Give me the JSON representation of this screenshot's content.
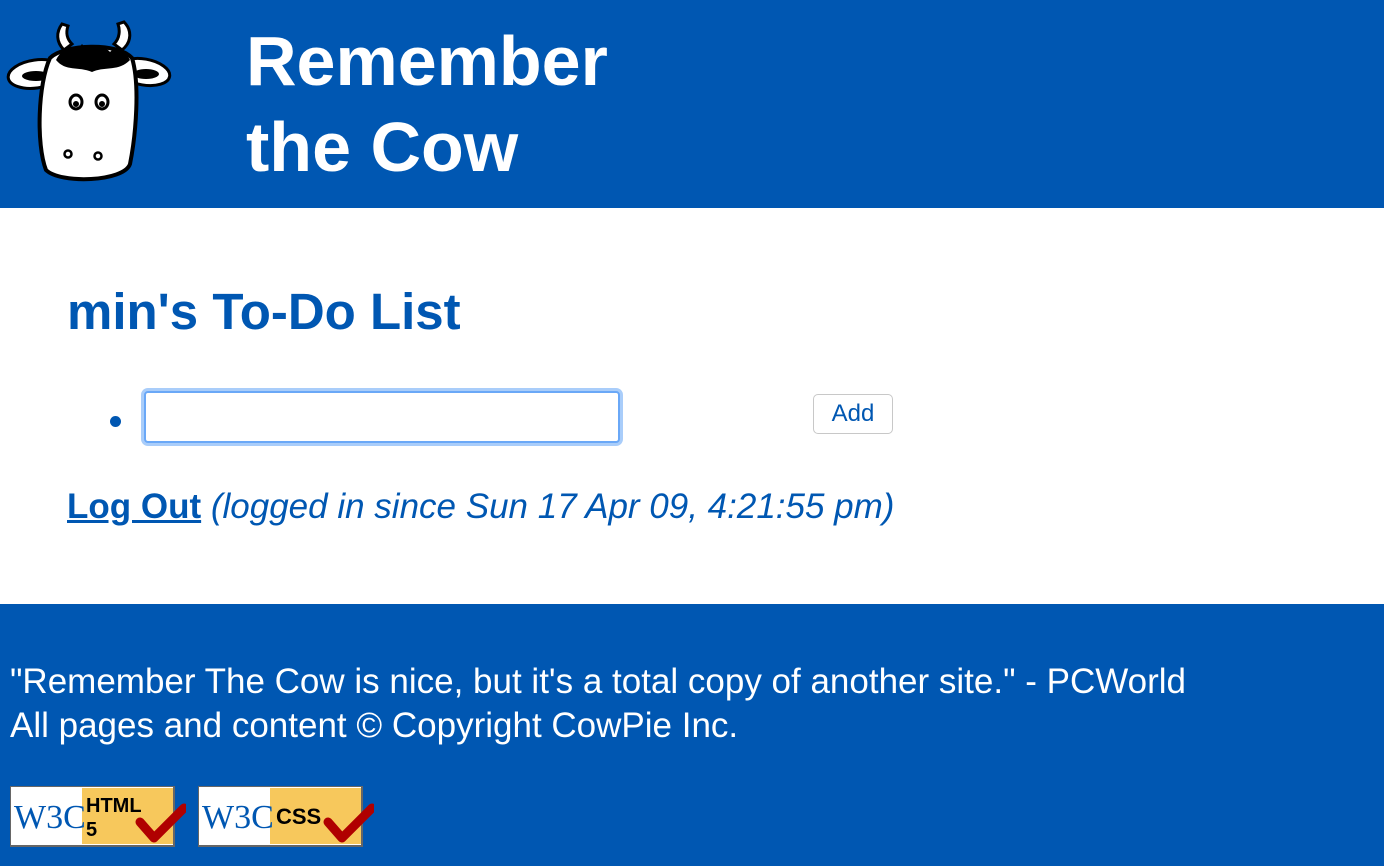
{
  "header": {
    "logo_name": "cow-logo",
    "title_line1": "Remember",
    "title_line2": "the Cow"
  },
  "main": {
    "page_title": "min's To-Do List",
    "todo_input": {
      "value": "",
      "placeholder": ""
    },
    "add_label": "Add",
    "logout_label": "Log Out",
    "login_status": "(logged in since Sun 17 Apr 09, 4:21:55 pm)"
  },
  "footer": {
    "quote": "\"Remember The Cow is nice, but it's a total copy of another site.\" - PCWorld",
    "copyright": "All pages and content © Copyright CowPie Inc.",
    "badges": [
      {
        "label": "W3C",
        "text1": "HTML",
        "text2": "5",
        "icon": "check-icon"
      },
      {
        "label": "W3C",
        "text1": "CSS",
        "icon": "check-icon"
      }
    ]
  },
  "colors": {
    "brand_blue": "#0057b2",
    "white": "#ffffff",
    "badge_yellow": "#f7c85c",
    "check_red": "#b00000"
  }
}
